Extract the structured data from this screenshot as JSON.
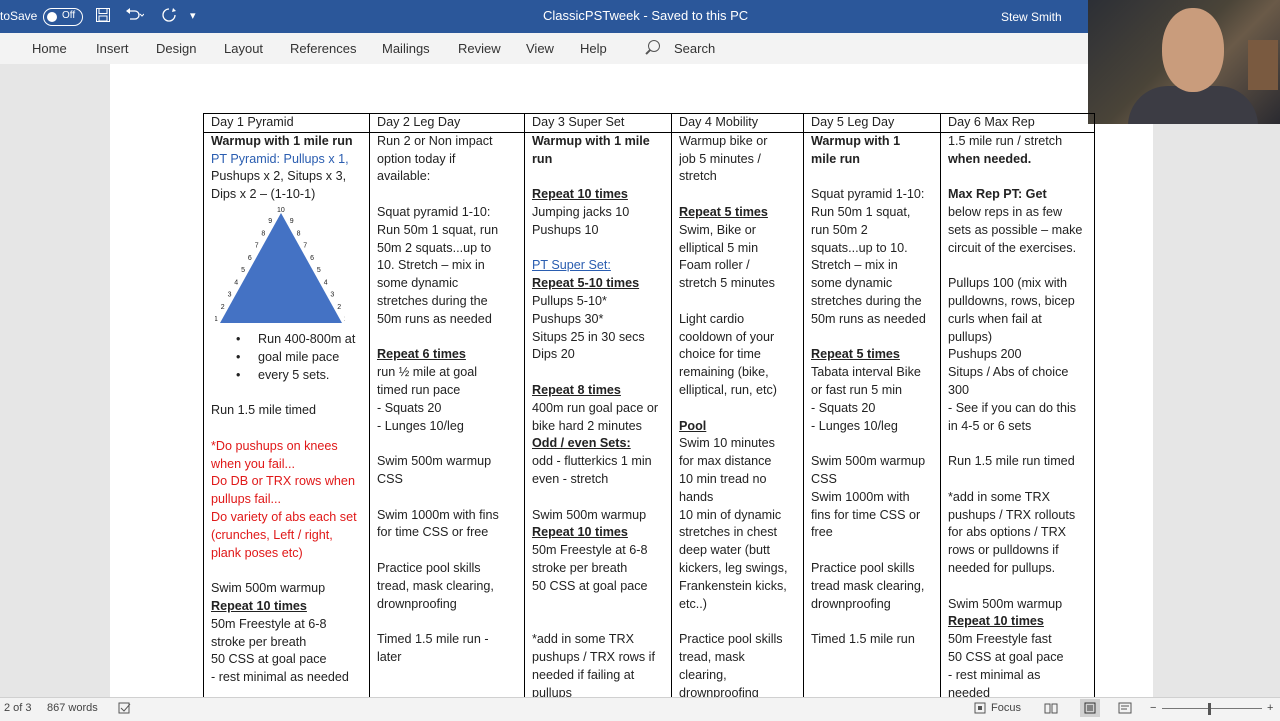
{
  "titlebar": {
    "autosave_label": "toSave",
    "autosave_state": "Off",
    "doc_title": "ClassicPSTweek  -  Saved to this PC",
    "user": "Stew Smith"
  },
  "ribbon": {
    "tabs": [
      "Home",
      "Insert",
      "Design",
      "Layout",
      "References",
      "Mailings",
      "Review",
      "View",
      "Help"
    ],
    "search_label": "Search"
  },
  "table": {
    "headers": [
      "Day 1 Pyramid",
      "Day 2 Leg Day",
      "Day 3 Super Set",
      "Day 4 Mobility",
      "Day 5 Leg Day",
      "Day 6 Max Rep"
    ],
    "pyramid_numbers": [
      "1",
      "2",
      "3",
      "4",
      "5",
      "6",
      "7",
      "8",
      "9",
      "10",
      "9",
      "8",
      "7",
      "6",
      "5",
      "4",
      "3",
      "2",
      "1"
    ],
    "col1_a": [
      "Warmup with 1 mile run",
      "PT Pyramid: Pullups x 1,",
      "Pushups x 2, Situps x 3,",
      "Dips x 2 – (1-10-1)"
    ],
    "col1_bullet": [
      "Run 400-800m at",
      "goal mile pace",
      "every 5 sets."
    ],
    "col1_b": [
      "",
      "Run 1.5 mile timed",
      "",
      "*Do pushups on knees",
      "when you fail...",
      "Do DB or TRX rows when",
      "pullups fail...",
      "Do variety of abs each set",
      "(crunches, Left / right,",
      "plank poses etc)",
      "",
      "Swim 500m warmup",
      "Repeat 10 times",
      "50m Freestyle at 6-8",
      "stroke per breath",
      "50 CSS at goal pace",
      "- rest minimal as needed"
    ],
    "col2": [
      "Run 2 or Non impact",
      "option today if",
      "available:",
      "",
      "Squat pyramid 1-10:",
      "Run 50m 1 squat, run",
      "50m 2 squats...up to",
      "10.  Stretch – mix in",
      "some dynamic",
      "stretches during the",
      "50m runs as needed",
      "",
      "Repeat 6 times",
      "run ½ mile at goal",
      "timed run pace",
      "- Squats 20",
      "- Lunges 10/leg",
      "",
      "Swim 500m warmup",
      "CSS",
      "",
      "Swim 1000m with fins",
      "for time CSS or free",
      "",
      "Practice pool skills",
      "tread, mask clearing,",
      "drownproofing",
      "",
      "Timed 1.5 mile run -",
      "later"
    ],
    "col3": [
      "Warmup with 1 mile",
      "run",
      "",
      "Repeat 10 times",
      "Jumping jacks 10",
      "Pushups 10",
      "",
      "PT Super Set:",
      "Repeat 5-10 times",
      "Pullups 5-10*",
      "Pushups 30*",
      "Situps 25 in 30 secs",
      "Dips 20",
      "",
      "Repeat 8 times",
      "400m run goal pace or",
      "bike hard 2 minutes",
      "Odd / even Sets:",
      "odd - flutterkics 1 min",
      "even - stretch",
      "",
      "Swim 500m warmup",
      "Repeat 10 times",
      "50m Freestyle at 6-8",
      "stroke per breath",
      "50 CSS at goal pace",
      "",
      "",
      "*add in some TRX",
      "pushups / TRX rows if",
      "needed if failing at",
      "pullups"
    ],
    "col4": [
      "Warmup bike or",
      "job 5 minutes /",
      "stretch",
      "",
      "Repeat 5 times",
      "Swim, Bike or",
      "elliptical 5 min",
      "Foam roller /",
      "stretch 5 minutes",
      "",
      "Light cardio",
      "cooldown of your",
      "choice for time",
      "remaining (bike,",
      "elliptical, run, etc)",
      "",
      "Pool",
      "Swim 10 minutes",
      "for max distance",
      "10 min tread no",
      "hands",
      "10 min of dynamic",
      "stretches in chest",
      "deep water (butt",
      "kickers, leg swings,",
      "Frankenstein kicks,",
      "etc..)",
      "",
      "Practice pool skills",
      "tread, mask",
      "clearing,",
      "drownproofing"
    ],
    "col5": [
      "Warmup with 1",
      "mile run",
      "",
      "Squat pyramid 1-10:",
      "Run 50m 1 squat,",
      "run 50m 2",
      "squats...up to 10.",
      "Stretch – mix in",
      "some dynamic",
      "stretches during the",
      "50m runs as needed",
      "",
      "Repeat 5 times",
      "Tabata interval Bike",
      "or fast run 5 min",
      "- Squats 20",
      "- Lunges 10/leg",
      "",
      "Swim 500m warmup",
      "CSS",
      "Swim 1000m with",
      "fins for time CSS or",
      "free",
      "",
      "Practice pool skills",
      "tread mask clearing,",
      "drownproofing",
      "",
      "Timed 1.5 mile run"
    ],
    "col6": [
      "1.5 mile run / stretch",
      "when needed.",
      "",
      "Max Rep PT:  Get",
      "below reps in as few",
      "sets as possible – make",
      "circuit of the exercises.",
      "",
      "Pullups 100 (mix with",
      "pulldowns, rows, bicep",
      "curls when fail at",
      "pullups)",
      "Pushups 200",
      "Situps / Abs of choice",
      "300",
      "- See if you can do this",
      "in 4-5 or 6 sets",
      "",
      "Run 1.5 mile run timed",
      "",
      "*add in some TRX",
      "pushups / TRX rollouts",
      "for abs options / TRX",
      "rows or pulldowns if",
      "needed for pullups.",
      "",
      "Swim 500m warmup",
      "Repeat 10 times",
      "50m Freestyle fast",
      "50 CSS at goal pace",
      "- rest minimal as",
      "needed"
    ]
  },
  "statusbar": {
    "page": "2 of 3",
    "words": "867 words",
    "focus": "Focus"
  },
  "colors": {
    "titlebar": "#2b579a",
    "pyramid": "#4472c4",
    "red_text": "#e01818",
    "link": "#2a5db0"
  }
}
